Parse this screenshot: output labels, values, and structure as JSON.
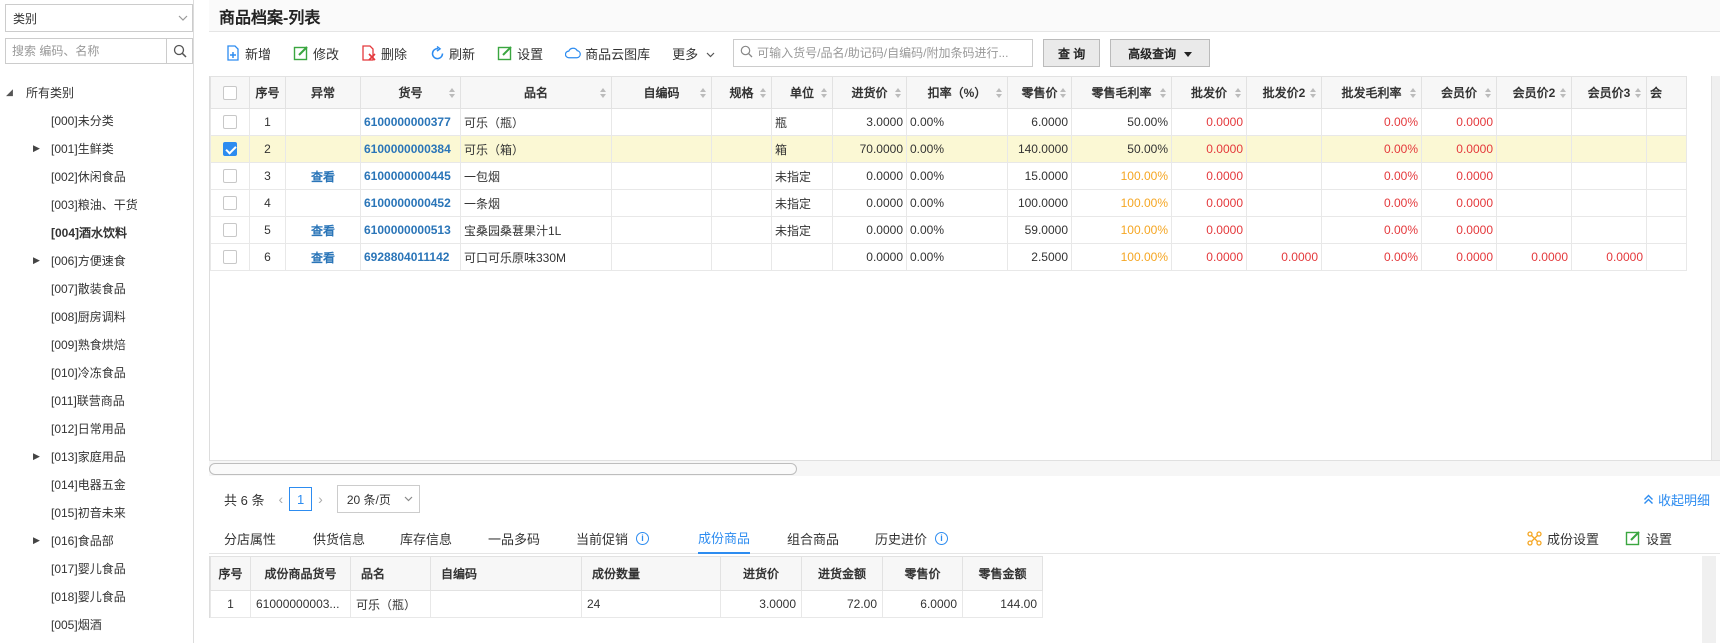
{
  "sidebar": {
    "category_select": "类别",
    "search_placeholder": "搜索 编码、名称",
    "root_label": "所有类别",
    "items": [
      {
        "label": "[000]未分类",
        "expandable": false,
        "bold": false
      },
      {
        "label": "[001]生鲜类",
        "expandable": true,
        "bold": false
      },
      {
        "label": "[002]休闲食品",
        "expandable": false,
        "bold": false
      },
      {
        "label": "[003]粮油、干货",
        "expandable": false,
        "bold": false
      },
      {
        "label": "[004]酒水饮料",
        "expandable": false,
        "bold": true
      },
      {
        "label": "[006]方便速食",
        "expandable": true,
        "bold": false
      },
      {
        "label": "[007]散装食品",
        "expandable": false,
        "bold": false
      },
      {
        "label": "[008]厨房调料",
        "expandable": false,
        "bold": false
      },
      {
        "label": "[009]熟食烘焙",
        "expandable": false,
        "bold": false
      },
      {
        "label": "[010]冷冻食品",
        "expandable": false,
        "bold": false
      },
      {
        "label": "[011]联营商品",
        "expandable": false,
        "bold": false
      },
      {
        "label": "[012]日常用品",
        "expandable": false,
        "bold": false
      },
      {
        "label": "[013]家庭用品",
        "expandable": true,
        "bold": false
      },
      {
        "label": "[014]电器五金",
        "expandable": false,
        "bold": false
      },
      {
        "label": "[015]初音未来",
        "expandable": false,
        "bold": false
      },
      {
        "label": "[016]食品部",
        "expandable": true,
        "bold": false
      },
      {
        "label": "[017]婴儿食品",
        "expandable": false,
        "bold": false
      },
      {
        "label": "[018]婴儿食品",
        "expandable": false,
        "bold": false
      },
      {
        "label": "[005]烟酒",
        "expandable": false,
        "bold": false
      }
    ]
  },
  "page_title": "商品档案-列表",
  "toolbar": {
    "add": "新增",
    "edit": "修改",
    "delete": "删除",
    "refresh": "刷新",
    "settings": "设置",
    "cloud_gallery": "商品云图库",
    "more": "更多",
    "search_placeholder": "可输入货号/品名/助记码/自编码/附加条码进行...",
    "query": "查 询",
    "advanced_query": "高级查询"
  },
  "grid": {
    "headers": [
      "序号",
      "异常",
      "货号",
      "品名",
      "自编码",
      "规格",
      "单位",
      "进货价",
      "扣率（%）",
      "零售价",
      "零售毛利率",
      "批发价",
      "批发价2",
      "批发毛利率",
      "会员价",
      "会员价2",
      "会员价3",
      "会"
    ],
    "rows": [
      {
        "no": "1",
        "abnormal": "",
        "code": "6100000000377",
        "name": "可乐（瓶）",
        "selfcode": "",
        "spec": "",
        "unit": "瓶",
        "cost": "3.0000",
        "discount": "0.00%",
        "retail": "6.0000",
        "margin": "50.00%",
        "wholesale": "0.0000",
        "wholesale2": "",
        "wmargin": "0.00%",
        "member": "0.0000",
        "member2": "",
        "member3": "",
        "checked": false
      },
      {
        "no": "2",
        "abnormal": "",
        "code": "6100000000384",
        "name": "可乐（箱）",
        "selfcode": "",
        "spec": "",
        "unit": "箱",
        "cost": "70.0000",
        "discount": "0.00%",
        "retail": "140.0000",
        "margin": "50.00%",
        "wholesale": "0.0000",
        "wholesale2": "",
        "wmargin": "0.00%",
        "member": "0.0000",
        "member2": "",
        "member3": "",
        "checked": true
      },
      {
        "no": "3",
        "abnormal": "查看",
        "code": "6100000000445",
        "name": "一包烟",
        "selfcode": "",
        "spec": "",
        "unit": "未指定",
        "cost": "0.0000",
        "discount": "0.00%",
        "retail": "15.0000",
        "margin": "100.00%",
        "wholesale": "0.0000",
        "wholesale2": "",
        "wmargin": "0.00%",
        "member": "0.0000",
        "member2": "",
        "member3": "",
        "checked": false
      },
      {
        "no": "4",
        "abnormal": "",
        "code": "6100000000452",
        "name": "一条烟",
        "selfcode": "",
        "spec": "",
        "unit": "未指定",
        "cost": "0.0000",
        "discount": "0.00%",
        "retail": "100.0000",
        "margin": "100.00%",
        "wholesale": "0.0000",
        "wholesale2": "",
        "wmargin": "0.00%",
        "member": "0.0000",
        "member2": "",
        "member3": "",
        "checked": false
      },
      {
        "no": "5",
        "abnormal": "查看",
        "code": "6100000000513",
        "name": "宝桑园桑葚果汁1L",
        "selfcode": "",
        "spec": "",
        "unit": "未指定",
        "cost": "0.0000",
        "discount": "0.00%",
        "retail": "59.0000",
        "margin": "100.00%",
        "wholesale": "0.0000",
        "wholesale2": "",
        "wmargin": "0.00%",
        "member": "0.0000",
        "member2": "",
        "member3": "",
        "checked": false
      },
      {
        "no": "6",
        "abnormal": "查看",
        "code": "6928804011142",
        "name": "可口可乐原味330M",
        "selfcode": "",
        "spec": "",
        "unit": "",
        "cost": "0.0000",
        "discount": "0.00%",
        "retail": "2.5000",
        "margin": "100.00%",
        "wholesale": "0.0000",
        "wholesale2": "0.0000",
        "wmargin": "0.00%",
        "member": "0.0000",
        "member2": "0.0000",
        "member3": "0.0000",
        "checked": false
      }
    ]
  },
  "pager": {
    "total": "共 6 条",
    "page": "1",
    "page_size": "20 条/页",
    "collapse": "收起明细"
  },
  "detail_tabs": {
    "tabs": [
      "分店属性",
      "供货信息",
      "库存信息",
      "一品多码",
      "当前促销",
      "成份商品",
      "组合商品",
      "历史进价"
    ],
    "active": "成份商品",
    "component_settings": "成份设置",
    "settings": "设置"
  },
  "detail_grid": {
    "headers": [
      "序号",
      "成份商品货号",
      "品名",
      "自编码",
      "成份数量",
      "进货价",
      "进货金额",
      "零售价",
      "零售金额"
    ],
    "rows": [
      {
        "no": "1",
        "code": "61000000003...",
        "name": "可乐（瓶）",
        "selfcode": "",
        "qty": "24",
        "cost": "3.0000",
        "cost_amt": "72.00",
        "retail": "6.0000",
        "retail_amt": "144.00"
      }
    ]
  },
  "colors": {
    "accent": "#2d8cf0",
    "link": "#2a75b8",
    "red": "#e4393c",
    "orange": "#f5a623",
    "selected_row": "#fbf8d4"
  }
}
